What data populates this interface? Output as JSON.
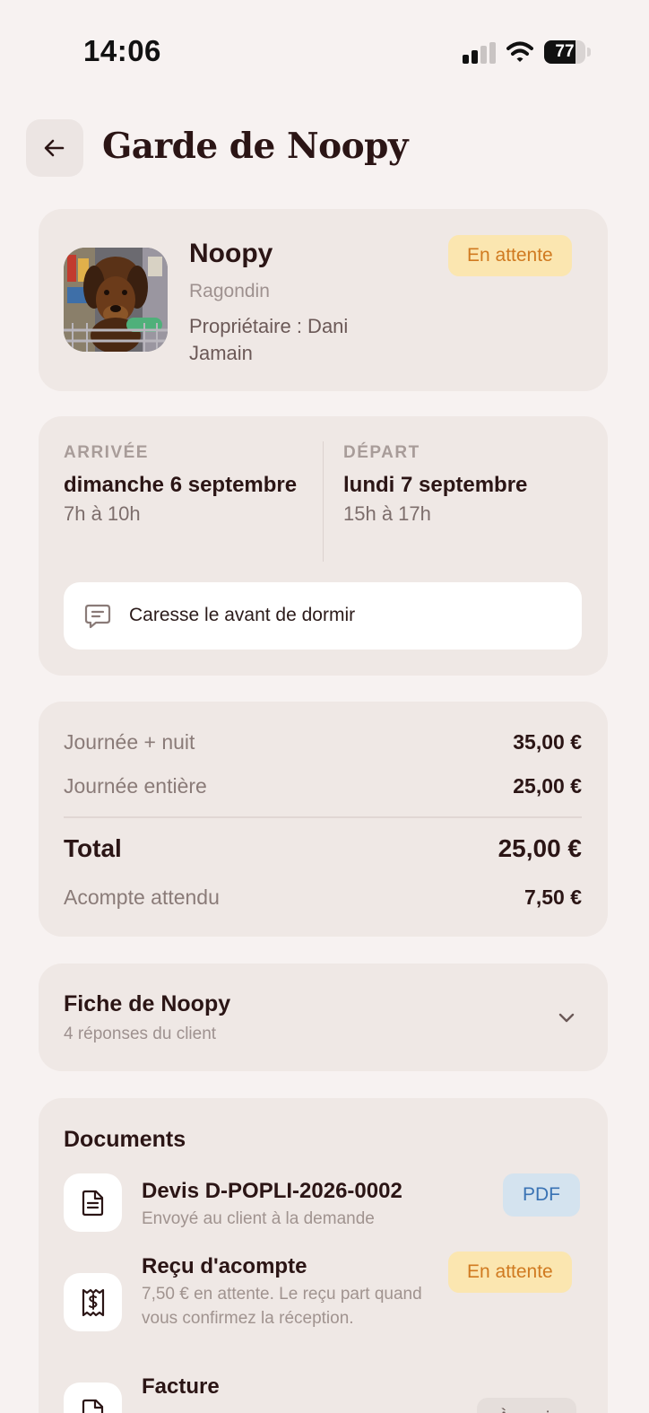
{
  "status_bar": {
    "time": "14:06",
    "battery": "77",
    "battery_fraction": 0.77,
    "icons": [
      "signal-icon",
      "wifi-icon",
      "battery-icon"
    ]
  },
  "header": {
    "title": "Garde de Noopy",
    "back_icon": "arrow-left-icon"
  },
  "pet": {
    "name": "Noopy",
    "breed": "Ragondin",
    "owner": "Propriétaire : Dani Jamain",
    "status": "En attente"
  },
  "stay": {
    "arrival_label": "ARRIVÉE",
    "arrival_date": "dimanche 6 septembre",
    "arrival_hours": "7h à 10h",
    "departure_label": "DÉPART",
    "departure_date": "lundi 7 septembre",
    "departure_hours": "15h à 17h",
    "note": "Caresse le avant de dormir",
    "note_icon": "message-icon"
  },
  "pricing": {
    "lines": [
      {
        "label": "Journée + nuit",
        "value": "35,00 €"
      },
      {
        "label": "Journée entière",
        "value": "25,00 €"
      }
    ],
    "total_label": "Total",
    "total_value": "25,00 €",
    "deposit_label": "Acompte attendu",
    "deposit_value": "7,50 €"
  },
  "fiche": {
    "title": "Fiche de Noopy",
    "subtitle": "4 réponses du client",
    "icon": "chevron-down-icon"
  },
  "documents": {
    "title": "Documents",
    "items": [
      {
        "name": "Devis D-POPLI-2026-0002",
        "desc": "Envoyé au client à la demande",
        "badge": "PDF",
        "icon": "document-icon"
      },
      {
        "name": "Reçu d'acompte",
        "desc": "7,50 € en attente. Le reçu part quand vous confirmez la réception.",
        "badge": "En attente",
        "icon": "receipt-icon"
      },
      {
        "name": "Facture",
        "desc": "",
        "badge": "À venir",
        "icon": "document-icon"
      }
    ]
  },
  "colors": {
    "background": "#f7f2f1",
    "card": "#efe8e5",
    "title": "#2b1515",
    "pending_bg": "#fbe6b0",
    "pending_text": "#d07a20",
    "pdf_bg": "#d4e3ef",
    "pdf_text": "#3a73b4"
  }
}
